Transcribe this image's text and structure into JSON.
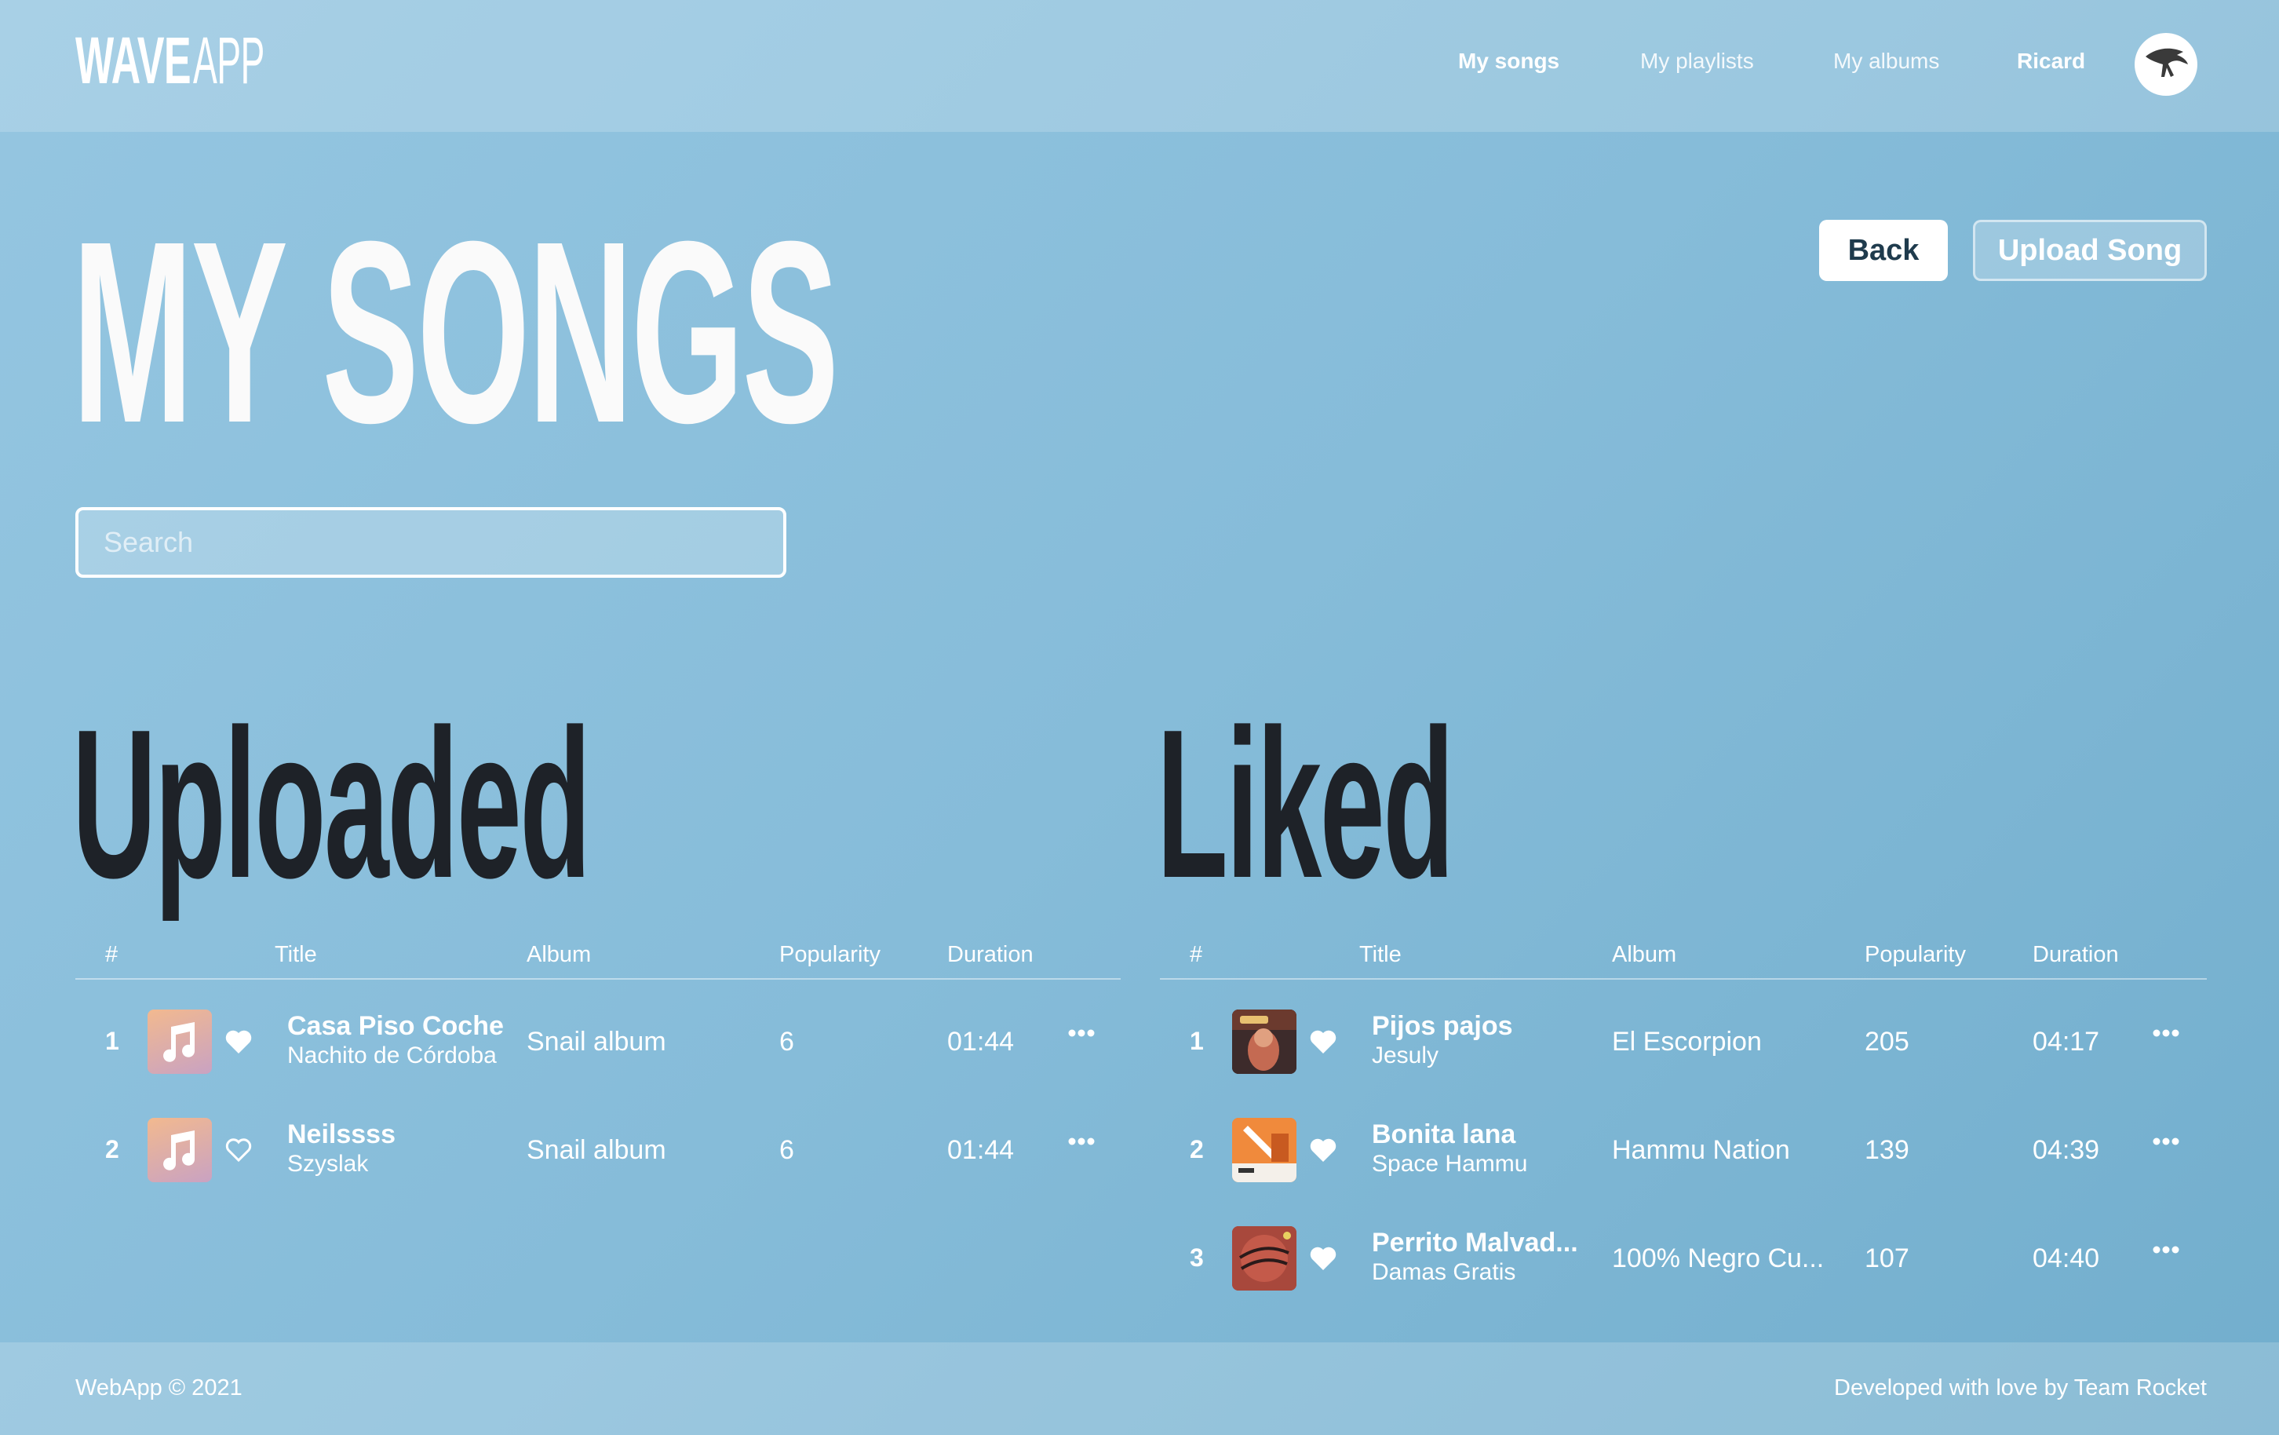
{
  "header": {
    "logo_bold": "WAVE",
    "logo_light": "APP",
    "nav": {
      "my_songs": "My songs",
      "my_playlists": "My playlists",
      "my_albums": "My albums",
      "user": "Ricard"
    }
  },
  "page": {
    "title": "MY SONGS",
    "back_label": "Back",
    "upload_label": "Upload Song",
    "search_placeholder": "Search"
  },
  "columns": {
    "num": "#",
    "title": "Title",
    "album": "Album",
    "popularity": "Popularity",
    "duration": "Duration"
  },
  "uploaded": {
    "heading": "Uploaded",
    "rows": [
      {
        "num": "1",
        "title": "Casa Piso Coche",
        "artist": "Nachito de Córdoba",
        "album": "Snail album",
        "popularity": "6",
        "duration": "01:44",
        "liked": true
      },
      {
        "num": "2",
        "title": "Neilssss",
        "artist": "Szyslak",
        "album": "Snail album",
        "popularity": "6",
        "duration": "01:44",
        "liked": false
      }
    ]
  },
  "liked": {
    "heading": "Liked",
    "rows": [
      {
        "num": "1",
        "title": "Pijos pajos",
        "artist": "Jesuly",
        "album": "El Escorpion",
        "popularity": "205",
        "duration": "04:17",
        "liked": true
      },
      {
        "num": "2",
        "title": "Bonita lana",
        "artist": "Space Hammu",
        "album": "Hammu Nation",
        "popularity": "139",
        "duration": "04:39",
        "liked": true
      },
      {
        "num": "3",
        "title": "Perrito Malvad...",
        "artist": "Damas Gratis",
        "album": "100% Negro Cu...",
        "popularity": "107",
        "duration": "04:40",
        "liked": true
      }
    ]
  },
  "footer": {
    "copyright": "WebApp © 2021",
    "credits": "Developed with love by Team Rocket"
  },
  "colors": {
    "accent_dark": "#1e2228",
    "background": "#86bcd9"
  }
}
